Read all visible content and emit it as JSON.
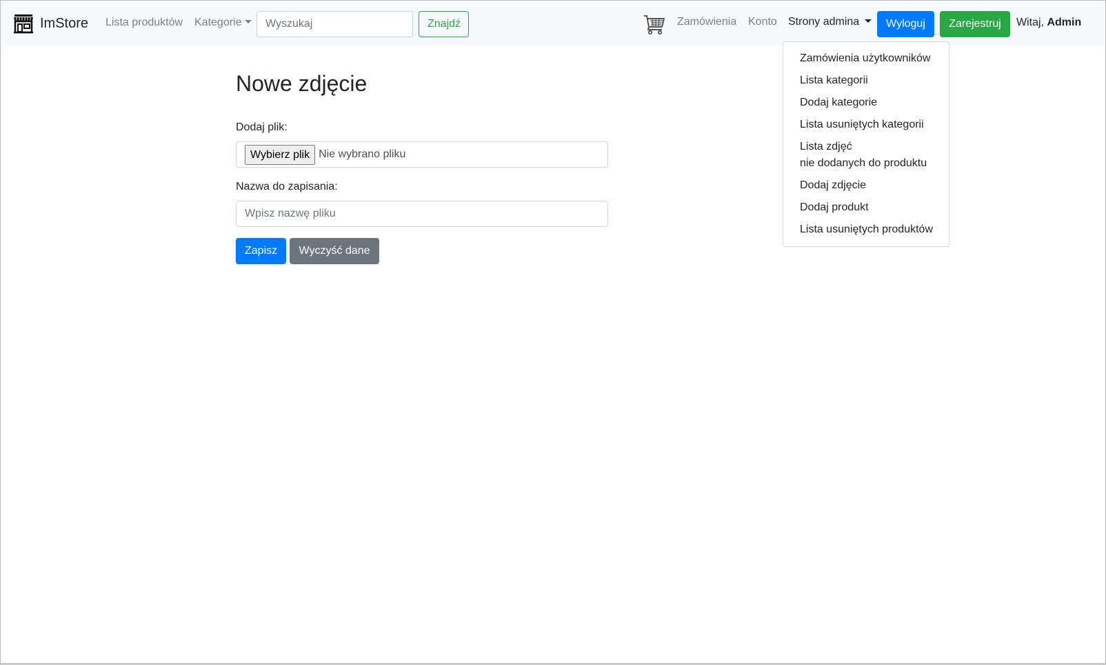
{
  "navbar": {
    "brand": {
      "icon": "store-icon",
      "text": "ImStore"
    },
    "links": {
      "products": "Lista produktów",
      "categories": "Kategorie",
      "orders": "Zamówienia",
      "account": "Konto",
      "admin_pages": "Strony admina"
    },
    "search": {
      "placeholder": "Wyszukaj",
      "value": "",
      "button": "Znajdź"
    },
    "cart_icon": "cart-icon",
    "logout_button": "Wyloguj",
    "register_button": "Zarejestruj",
    "greeting": {
      "prefix": "Witaj,",
      "user": "Admin"
    }
  },
  "admin_dropdown": {
    "items": [
      {
        "label": "Zamówienia użytkowników"
      },
      {
        "label": "Lista kategorii"
      },
      {
        "label": "Dodaj kategorie"
      },
      {
        "label": "Lista usuniętych kategorii"
      },
      {
        "label": "Lista zdjęć",
        "label2": "nie dodanych do produktu"
      },
      {
        "label": "Dodaj zdjęcie"
      },
      {
        "label": "Dodaj produkt"
      },
      {
        "label": "Lista usuniętych produktów"
      }
    ]
  },
  "form": {
    "title": "Nowe zdjęcie",
    "file_label": "Dodaj plik:",
    "file_button": "Wybierz plik",
    "file_status": "Nie wybrano pliku",
    "name_label": "Nazwa do zapisania:",
    "name_placeholder": "Wpisz nazwę pliku",
    "name_value": "",
    "save_button": "Zapisz",
    "clear_button": "Wyczyść dane"
  },
  "colors": {
    "primary": "#007bff",
    "success": "#28a745",
    "secondary": "#6c757d",
    "navbar_bg": "#f8f9fa"
  }
}
